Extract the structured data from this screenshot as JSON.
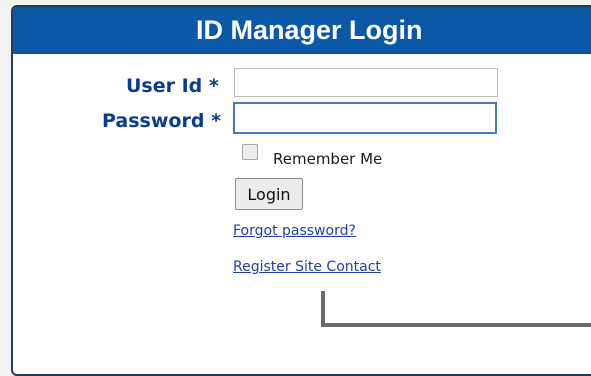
{
  "header": {
    "title": "ID Manager Login"
  },
  "form": {
    "userid_label": "User Id",
    "password_label": "Password",
    "required_mark": "*",
    "userid_value": "",
    "password_value": "",
    "remember_label": "Remember Me",
    "login_button": "Login"
  },
  "links": {
    "forgot": "Forgot password?",
    "register": "Register Site Contact"
  },
  "colors": {
    "header_bg": "#0a58a6",
    "label": "#0a3d91",
    "link": "#1f3fb0"
  }
}
